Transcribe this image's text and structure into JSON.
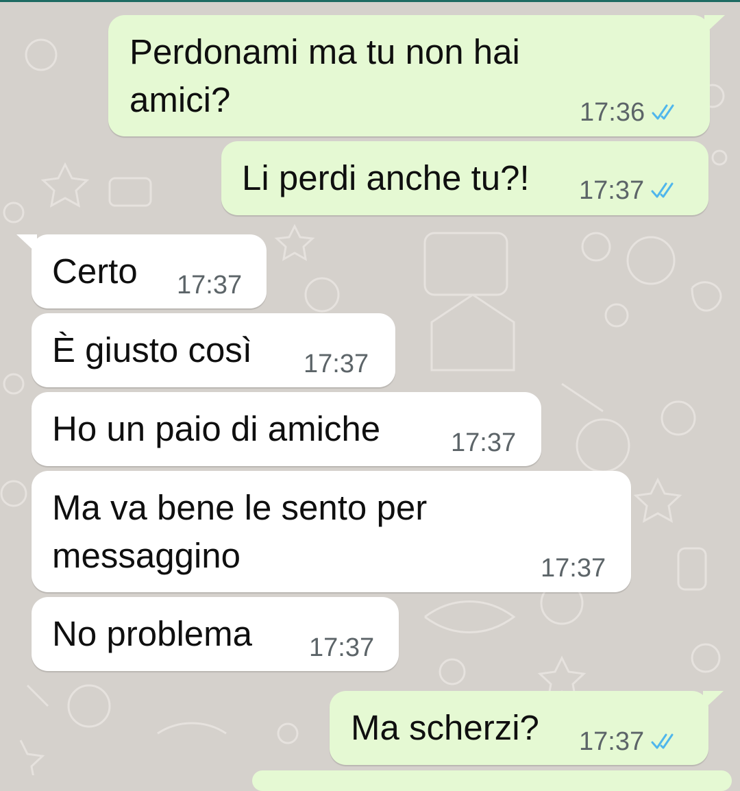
{
  "colors": {
    "wallpaper": "#d5d1cc",
    "outgoing_bubble": "#e5f9d3",
    "incoming_bubble": "#ffffff",
    "read_ticks": "#4fb6ec",
    "timestamp": "#5c6468"
  },
  "messages": [
    {
      "direction": "outgoing",
      "lines": [
        "Perdonami ma tu non hai",
        "amici?"
      ],
      "time": "17:36",
      "status": "read",
      "status_icon": "double-check-icon"
    },
    {
      "direction": "outgoing",
      "lines": [
        "Li perdi anche tu?!"
      ],
      "time": "17:37",
      "status": "read",
      "status_icon": "double-check-icon"
    },
    {
      "direction": "incoming",
      "lines": [
        "Certo"
      ],
      "time": "17:37"
    },
    {
      "direction": "incoming",
      "lines": [
        "È giusto così"
      ],
      "time": "17:37"
    },
    {
      "direction": "incoming",
      "lines": [
        "Ho un paio di amiche"
      ],
      "time": "17:37"
    },
    {
      "direction": "incoming",
      "lines": [
        "Ma va bene le sento per",
        "messaggino"
      ],
      "time": "17:37"
    },
    {
      "direction": "incoming",
      "lines": [
        "No problema"
      ],
      "time": "17:37"
    },
    {
      "direction": "outgoing",
      "lines": [
        "Ma scherzi?"
      ],
      "time": "17:37",
      "status": "read",
      "status_icon": "double-check-icon"
    }
  ]
}
